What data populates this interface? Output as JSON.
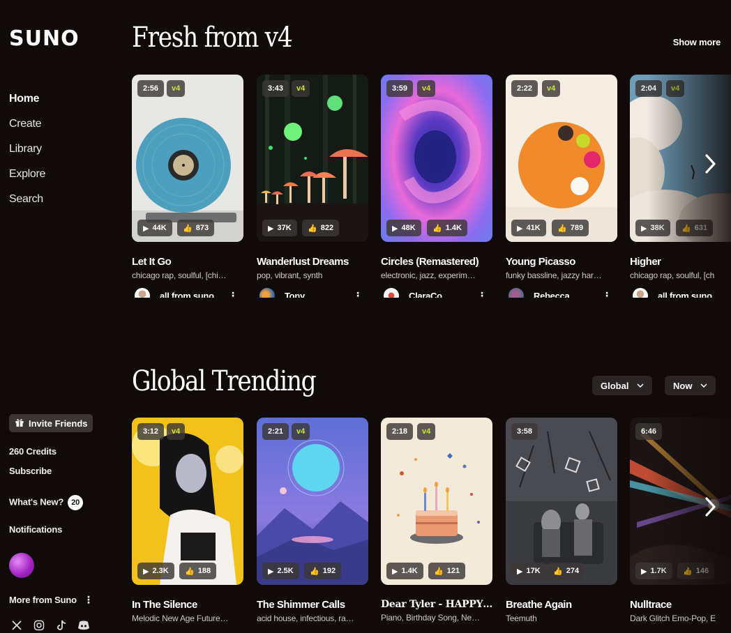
{
  "logo": "SUNO",
  "nav": [
    "Home",
    "Create",
    "Library",
    "Explore",
    "Search"
  ],
  "sidebar": {
    "invite": "Invite Friends",
    "credits": "260 Credits",
    "subscribe": "Subscribe",
    "whats_new": "What's New?",
    "whats_new_count": "20",
    "notifications": "Notifications",
    "more_from": "More from Suno",
    "socials": [
      "x-icon",
      "instagram-icon",
      "tiktok-icon",
      "discord-icon"
    ]
  },
  "sections": {
    "fresh": {
      "title": "Fresh from v4",
      "show_more": "Show more",
      "cards": [
        {
          "duration": "2:56",
          "version": "v4",
          "plays": "44K",
          "likes": "873",
          "title": "Let It Go",
          "tags": "chicago rap, soulful, [chi…",
          "user": "all from suno …"
        },
        {
          "duration": "3:43",
          "version": "v4",
          "plays": "37K",
          "likes": "822",
          "title": "Wanderlust Dreams",
          "tags": "pop, vibrant, synth",
          "user": "Tony"
        },
        {
          "duration": "3:59",
          "version": "v4",
          "plays": "48K",
          "likes": "1.4K",
          "title": "Circles (Remastered)",
          "tags": "electronic, jazz, experim…",
          "user": "ClaraCo"
        },
        {
          "duration": "2:22",
          "version": "v4",
          "plays": "41K",
          "likes": "789",
          "title": "Young Picasso",
          "tags": "funky bassline, jazzy har…",
          "user": "Rebecca"
        },
        {
          "duration": "2:04",
          "version": "v4",
          "plays": "38K",
          "likes": "631",
          "title": "Higher",
          "tags": "chicago rap, soulful, [ch",
          "user": "all from suno …"
        }
      ]
    },
    "trending": {
      "title": "Global Trending",
      "filter_region": "Global",
      "filter_time": "Now",
      "cards": [
        {
          "duration": "3:12",
          "version": "v4",
          "plays": "2.3K",
          "likes": "188",
          "title": "In The Silence",
          "tags": "Melodic New Age Future…"
        },
        {
          "duration": "2:21",
          "version": "v4",
          "plays": "2.5K",
          "likes": "192",
          "title": "The Shimmer Calls",
          "tags": "acid house, infectious, ra…"
        },
        {
          "duration": "2:18",
          "version": "v4",
          "plays": "1.4K",
          "likes": "121",
          "title": "Dear Tyler - HAPPY…",
          "tags": "Piano, Birthday Song, Ne…"
        },
        {
          "duration": "3:58",
          "version": "",
          "plays": "17K",
          "likes": "274",
          "title": "Breathe Again",
          "tags": "Teemuth"
        },
        {
          "duration": "6:46",
          "version": "",
          "plays": "1.7K",
          "likes": "146",
          "title": "Nulltrace",
          "tags": "Dark Glitch Emo-Pop, E"
        }
      ]
    }
  }
}
